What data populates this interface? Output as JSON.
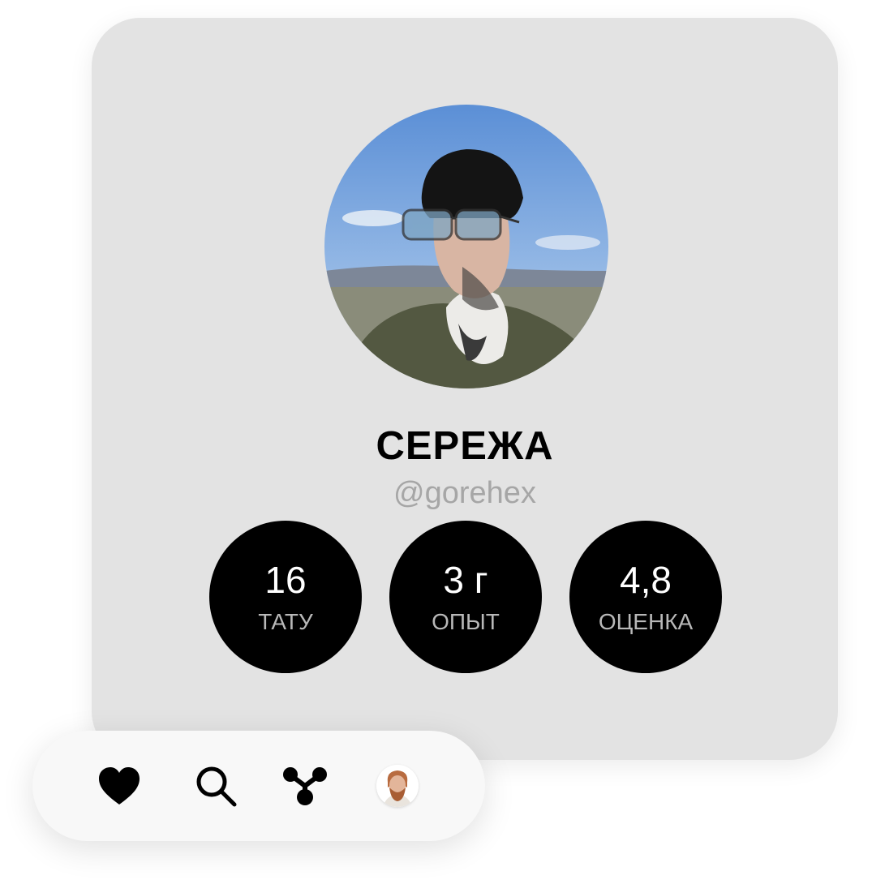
{
  "profile": {
    "name": "СЕРЕЖА",
    "username": "@gorehex",
    "avatar": "profile-photo"
  },
  "stats": [
    {
      "value": "16",
      "label": "ТАТУ"
    },
    {
      "value": "3 г",
      "label": "ОПЫТ"
    },
    {
      "value": "4,8",
      "label": "ОЦЕНКА"
    }
  ],
  "nav": [
    {
      "icon": "heart-icon"
    },
    {
      "icon": "search-icon"
    },
    {
      "icon": "share-icon"
    },
    {
      "icon": "user-avatar"
    }
  ],
  "colors": {
    "card_background": "#e3e3e3",
    "stat_circle": "#000000",
    "username": "#a6a6a6",
    "stat_label": "#b8b8b8",
    "nav_background": "#f8f8f8"
  }
}
